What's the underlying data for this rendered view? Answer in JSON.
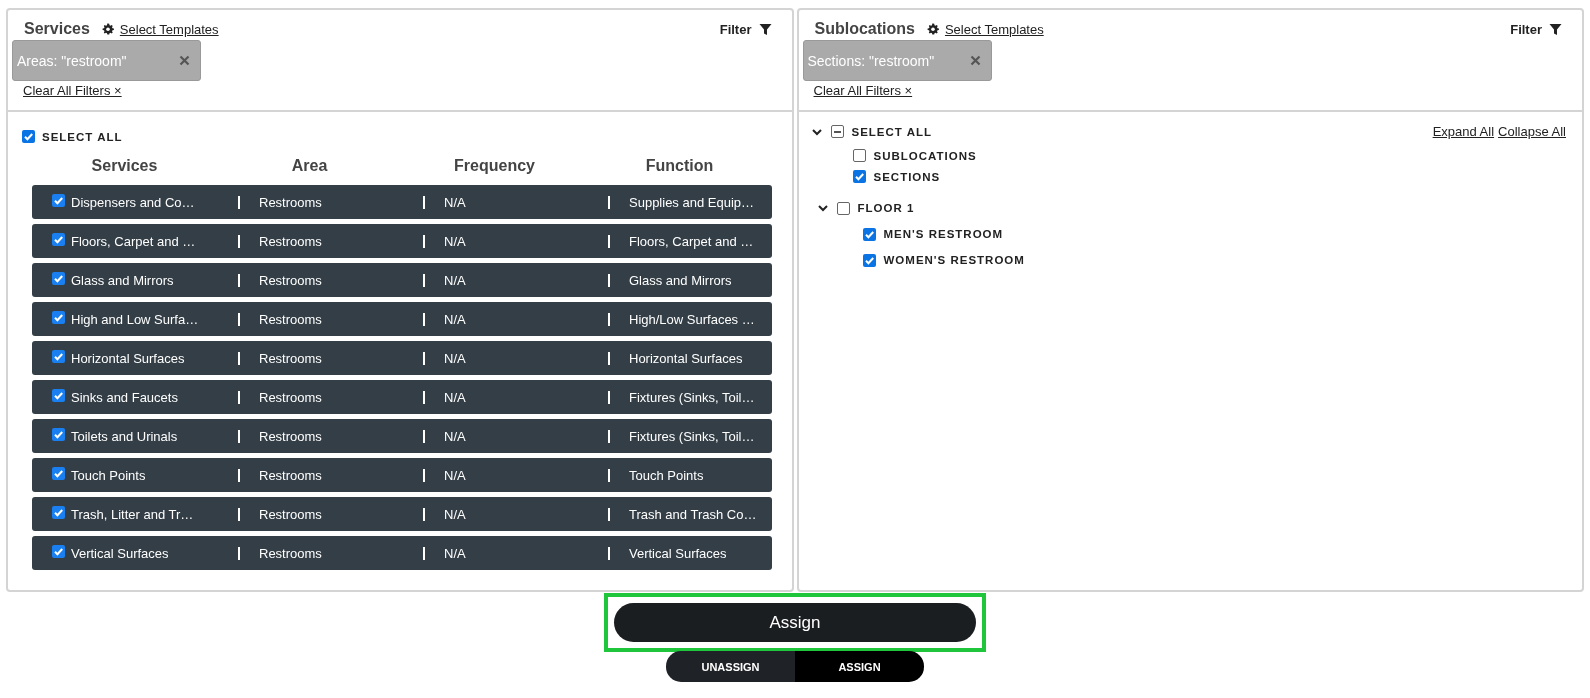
{
  "services_panel": {
    "title": "Services",
    "templates_link": "Select Templates",
    "filter_label": "Filter",
    "filter_chips": [
      "Areas: \"restroom\""
    ],
    "clear_filters": "Clear All Filters ×",
    "select_all": {
      "label": "SELECT ALL",
      "checked": true
    },
    "columns": [
      "Services",
      "Area",
      "Frequency",
      "Function"
    ],
    "rows": [
      {
        "checked": true,
        "cells": [
          "Dispensers and Co…",
          "Restrooms",
          "N/A",
          "Supplies and Equip…"
        ]
      },
      {
        "checked": true,
        "cells": [
          "Floors, Carpet and …",
          "Restrooms",
          "N/A",
          "Floors, Carpet and …"
        ]
      },
      {
        "checked": true,
        "cells": [
          "Glass and Mirrors",
          "Restrooms",
          "N/A",
          "Glass and Mirrors"
        ]
      },
      {
        "checked": true,
        "cells": [
          "High and Low Surfa…",
          "Restrooms",
          "N/A",
          "High/Low Surfaces …"
        ]
      },
      {
        "checked": true,
        "cells": [
          "Horizontal Surfaces",
          "Restrooms",
          "N/A",
          "Horizontal Surfaces"
        ]
      },
      {
        "checked": true,
        "cells": [
          "Sinks and Faucets",
          "Restrooms",
          "N/A",
          "Fixtures (Sinks, Toil…"
        ]
      },
      {
        "checked": true,
        "cells": [
          "Toilets and Urinals",
          "Restrooms",
          "N/A",
          "Fixtures (Sinks, Toil…"
        ]
      },
      {
        "checked": true,
        "cells": [
          "Touch Points",
          "Restrooms",
          "N/A",
          "Touch Points"
        ]
      },
      {
        "checked": true,
        "cells": [
          "Trash, Litter and Tr…",
          "Restrooms",
          "N/A",
          "Trash and Trash Co…"
        ]
      },
      {
        "checked": true,
        "cells": [
          "Vertical Surfaces",
          "Restrooms",
          "N/A",
          "Vertical Surfaces"
        ]
      }
    ]
  },
  "sublocations_panel": {
    "title": "Sublocations",
    "templates_link": "Select Templates",
    "filter_label": "Filter",
    "filter_chips": [
      "Sections: \"restroom\""
    ],
    "clear_filters": "Clear All Filters ×",
    "select_all": {
      "label": "SELECT ALL",
      "indeterminate": true,
      "expanded": true
    },
    "expand_all": "Expand All",
    "collapse_all": "Collapse All",
    "type_options": [
      {
        "label": "SUBLOCATIONS",
        "checked": false
      },
      {
        "label": "SECTIONS",
        "checked": true
      }
    ],
    "tree": [
      {
        "label": "FLOOR 1",
        "checked": false,
        "expanded": true,
        "children": [
          {
            "label": "MEN'S RESTROOM",
            "checked": true
          },
          {
            "label": "WOMEN'S RESTROOM",
            "checked": true
          }
        ]
      }
    ]
  },
  "assign_button": {
    "label": "Assign",
    "highlighted": true
  },
  "mode_toggle": [
    {
      "label": "UNASSIGN",
      "selected": false
    },
    {
      "label": "ASSIGN",
      "selected": true
    }
  ]
}
